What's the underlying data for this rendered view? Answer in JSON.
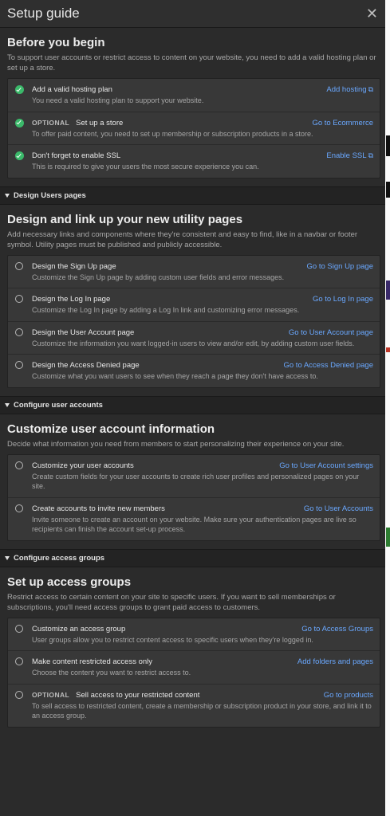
{
  "app": {
    "title": "Setup guide"
  },
  "before": {
    "heading": "Before you begin",
    "description": "To support user accounts or restrict access to content on your website, you need to add a valid hosting plan or set up a store.",
    "items": [
      {
        "title": "Add a valid hosting plan",
        "desc": "You need a valid hosting plan to support your website.",
        "link": "Add hosting",
        "optional": "",
        "link_icon": "external-link-icon"
      },
      {
        "title": "Set up a store",
        "desc": "To offer paid content, you need to set up membership or subscription products in a store.",
        "link": "Go to Ecommerce",
        "optional": "OPTIONAL"
      },
      {
        "title": "Don't forget to enable SSL",
        "desc": "This is required to give your users the most secure experience you can.",
        "link": "Enable SSL",
        "optional": "",
        "link_icon": "external-link-icon"
      }
    ]
  },
  "design": {
    "section_label": "Design Users pages",
    "heading": "Design and link up your new utility pages",
    "description": "Add necessary links and components where they're consistent and easy to find, like in a navbar or footer symbol. Utility pages must be published and publicly accessible.",
    "items": [
      {
        "title": "Design the Sign Up page",
        "desc": "Customize the Sign Up page by adding custom user fields and error messages.",
        "link": "Go to Sign Up page"
      },
      {
        "title": "Design the Log In page",
        "desc": "Customize the Log In page by adding a Log In link and customizing error messages.",
        "link": "Go to Log In page"
      },
      {
        "title": "Design the User Account page",
        "desc": "Customize the information you want logged-in users to view and/or edit, by adding custom user fields.",
        "link": "Go to User Account page"
      },
      {
        "title": "Design the Access Denied page",
        "desc": "Customize what you want users to see when they reach a page they don't have access to.",
        "link": "Go to Access Denied page"
      }
    ]
  },
  "accounts": {
    "section_label": "Configure user accounts",
    "heading": "Customize user account information",
    "description": "Decide what information you need from members to start personalizing their experience on your site.",
    "items": [
      {
        "title": "Customize your user accounts",
        "desc": "Create custom fields for your user accounts to create rich user profiles and personalized pages on your site.",
        "link": "Go to User Account settings"
      },
      {
        "title": "Create accounts to invite new members",
        "desc": "Invite someone to create an account on your website. Make sure your authentication pages are live so recipients can finish the account set-up process.",
        "link": "Go to User Accounts"
      }
    ]
  },
  "access": {
    "section_label": "Configure access groups",
    "heading": "Set up access groups",
    "description": "Restrict access to certain content on your site to specific users. If you want to sell memberships or subscriptions, you'll need access groups to grant paid access to customers.",
    "items": [
      {
        "title": "Customize an access group",
        "desc": "User groups allow you to restrict content access to specific users when they're logged in.",
        "link": "Go to Access Groups"
      },
      {
        "title": "Make content restricted access only",
        "desc": "Choose the content you want to restrict access to.",
        "link": "Add folders and pages"
      },
      {
        "title": "Sell access to your restricted content",
        "desc": "To sell access to restricted content, create a membership or subscription product in your store, and link it to an access group.",
        "link": "Go to products",
        "optional": "OPTIONAL"
      }
    ]
  },
  "colors": {
    "accent": "#6aa8ff",
    "check": "#3bb96a",
    "panel": "#2b2b2b",
    "card": "#383838"
  }
}
